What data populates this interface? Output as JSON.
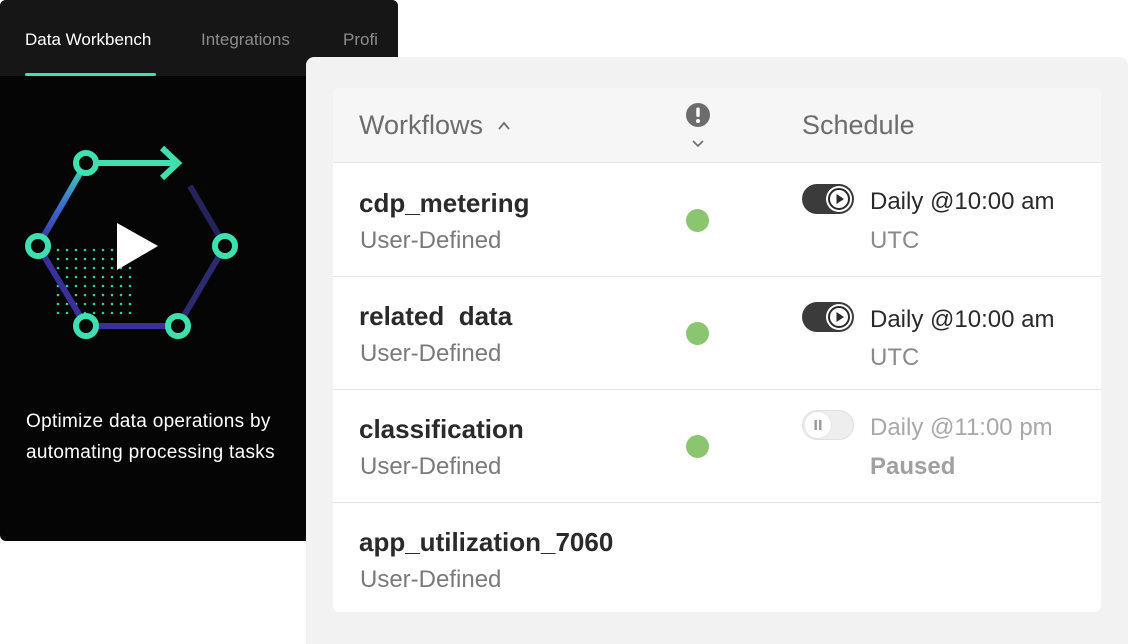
{
  "nav": {
    "tabs": [
      {
        "label": "Data Workbench",
        "active": true
      },
      {
        "label": "Integrations",
        "active": false
      },
      {
        "label": "Profi",
        "active": false
      }
    ]
  },
  "hero": {
    "tagline": "Optimize data operations by  automating processing tasks",
    "accent": "#3fe0b0"
  },
  "table": {
    "headers": {
      "workflows": "Workflows",
      "schedule": "Schedule"
    },
    "rows": [
      {
        "name": "cdp_metering",
        "type": "User-Defined",
        "status": "active",
        "toggle": "on",
        "schedule": "Daily @10:00 am",
        "timezone": "UTC"
      },
      {
        "name": "related  data",
        "type": "User-Defined",
        "status": "active",
        "toggle": "on",
        "schedule": "Daily @10:00 am",
        "timezone": "UTC"
      },
      {
        "name": "classification",
        "type": "User-Defined",
        "status": "active",
        "toggle": "paused",
        "schedule": "Daily @11:00 pm",
        "timezone": "Paused"
      },
      {
        "name": "app_utilization_7060",
        "type": "User-Defined"
      }
    ]
  },
  "colors": {
    "status_green": "#8cc570",
    "toggle_dark": "#3b3b3b"
  }
}
